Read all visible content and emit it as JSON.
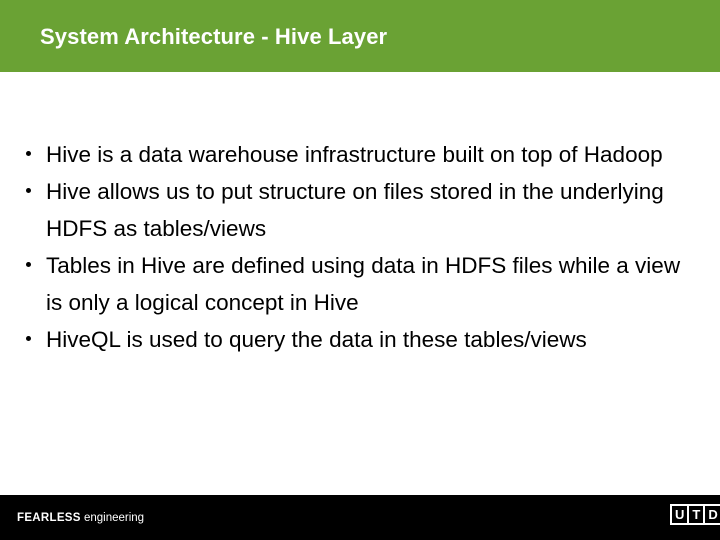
{
  "slide": {
    "title": "System Architecture - Hive Layer",
    "header_color": "#6AA234",
    "title_color": "#FFFFFF",
    "background_color": "#FFFFFF",
    "body_text_color": "#000000"
  },
  "content": {
    "bullets": [
      {
        "text": "Hive is a data warehouse infrastructure built on top of Hadoop",
        "align": "left"
      },
      {
        "text": "Hive allows us to put structure on files stored in the underlying HDFS as tables/views",
        "align": "left"
      },
      {
        "text": "Tables in Hive are defined using data in HDFS files while a view is only a logical concept in Hive",
        "align": "left"
      },
      {
        "text": "HiveQL is used to query the data in these tables/views",
        "align": "justify"
      }
    ]
  },
  "footer": {
    "background_color": "#000000",
    "brand_bold": "FEARLESS",
    "brand_regular": "engineering",
    "logo": {
      "name": "utd-logo",
      "letters": [
        "U",
        "T",
        "D"
      ],
      "color": "#FFFFFF"
    }
  }
}
